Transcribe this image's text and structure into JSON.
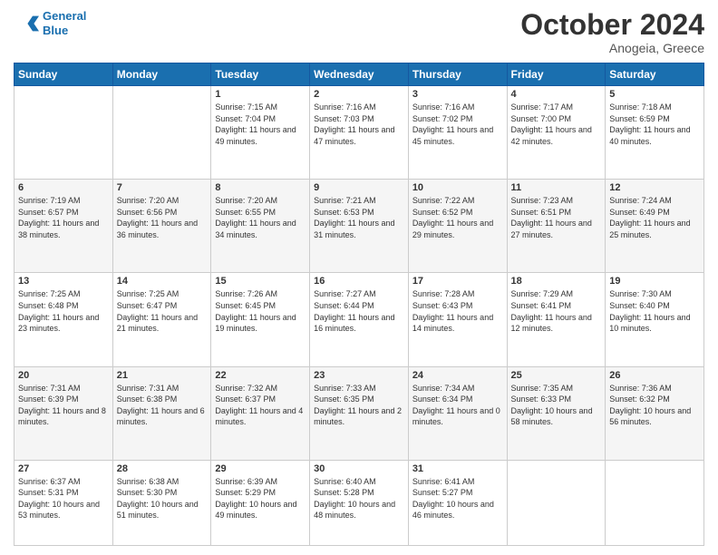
{
  "logo": {
    "line1": "General",
    "line2": "Blue"
  },
  "header": {
    "month": "October 2024",
    "location": "Anogeia, Greece"
  },
  "weekdays": [
    "Sunday",
    "Monday",
    "Tuesday",
    "Wednesday",
    "Thursday",
    "Friday",
    "Saturday"
  ],
  "weeks": [
    [
      {
        "day": "",
        "info": ""
      },
      {
        "day": "",
        "info": ""
      },
      {
        "day": "1",
        "info": "Sunrise: 7:15 AM\nSunset: 7:04 PM\nDaylight: 11 hours and 49 minutes."
      },
      {
        "day": "2",
        "info": "Sunrise: 7:16 AM\nSunset: 7:03 PM\nDaylight: 11 hours and 47 minutes."
      },
      {
        "day": "3",
        "info": "Sunrise: 7:16 AM\nSunset: 7:02 PM\nDaylight: 11 hours and 45 minutes."
      },
      {
        "day": "4",
        "info": "Sunrise: 7:17 AM\nSunset: 7:00 PM\nDaylight: 11 hours and 42 minutes."
      },
      {
        "day": "5",
        "info": "Sunrise: 7:18 AM\nSunset: 6:59 PM\nDaylight: 11 hours and 40 minutes."
      }
    ],
    [
      {
        "day": "6",
        "info": "Sunrise: 7:19 AM\nSunset: 6:57 PM\nDaylight: 11 hours and 38 minutes."
      },
      {
        "day": "7",
        "info": "Sunrise: 7:20 AM\nSunset: 6:56 PM\nDaylight: 11 hours and 36 minutes."
      },
      {
        "day": "8",
        "info": "Sunrise: 7:20 AM\nSunset: 6:55 PM\nDaylight: 11 hours and 34 minutes."
      },
      {
        "day": "9",
        "info": "Sunrise: 7:21 AM\nSunset: 6:53 PM\nDaylight: 11 hours and 31 minutes."
      },
      {
        "day": "10",
        "info": "Sunrise: 7:22 AM\nSunset: 6:52 PM\nDaylight: 11 hours and 29 minutes."
      },
      {
        "day": "11",
        "info": "Sunrise: 7:23 AM\nSunset: 6:51 PM\nDaylight: 11 hours and 27 minutes."
      },
      {
        "day": "12",
        "info": "Sunrise: 7:24 AM\nSunset: 6:49 PM\nDaylight: 11 hours and 25 minutes."
      }
    ],
    [
      {
        "day": "13",
        "info": "Sunrise: 7:25 AM\nSunset: 6:48 PM\nDaylight: 11 hours and 23 minutes."
      },
      {
        "day": "14",
        "info": "Sunrise: 7:25 AM\nSunset: 6:47 PM\nDaylight: 11 hours and 21 minutes."
      },
      {
        "day": "15",
        "info": "Sunrise: 7:26 AM\nSunset: 6:45 PM\nDaylight: 11 hours and 19 minutes."
      },
      {
        "day": "16",
        "info": "Sunrise: 7:27 AM\nSunset: 6:44 PM\nDaylight: 11 hours and 16 minutes."
      },
      {
        "day": "17",
        "info": "Sunrise: 7:28 AM\nSunset: 6:43 PM\nDaylight: 11 hours and 14 minutes."
      },
      {
        "day": "18",
        "info": "Sunrise: 7:29 AM\nSunset: 6:41 PM\nDaylight: 11 hours and 12 minutes."
      },
      {
        "day": "19",
        "info": "Sunrise: 7:30 AM\nSunset: 6:40 PM\nDaylight: 11 hours and 10 minutes."
      }
    ],
    [
      {
        "day": "20",
        "info": "Sunrise: 7:31 AM\nSunset: 6:39 PM\nDaylight: 11 hours and 8 minutes."
      },
      {
        "day": "21",
        "info": "Sunrise: 7:31 AM\nSunset: 6:38 PM\nDaylight: 11 hours and 6 minutes."
      },
      {
        "day": "22",
        "info": "Sunrise: 7:32 AM\nSunset: 6:37 PM\nDaylight: 11 hours and 4 minutes."
      },
      {
        "day": "23",
        "info": "Sunrise: 7:33 AM\nSunset: 6:35 PM\nDaylight: 11 hours and 2 minutes."
      },
      {
        "day": "24",
        "info": "Sunrise: 7:34 AM\nSunset: 6:34 PM\nDaylight: 11 hours and 0 minutes."
      },
      {
        "day": "25",
        "info": "Sunrise: 7:35 AM\nSunset: 6:33 PM\nDaylight: 10 hours and 58 minutes."
      },
      {
        "day": "26",
        "info": "Sunrise: 7:36 AM\nSunset: 6:32 PM\nDaylight: 10 hours and 56 minutes."
      }
    ],
    [
      {
        "day": "27",
        "info": "Sunrise: 6:37 AM\nSunset: 5:31 PM\nDaylight: 10 hours and 53 minutes."
      },
      {
        "day": "28",
        "info": "Sunrise: 6:38 AM\nSunset: 5:30 PM\nDaylight: 10 hours and 51 minutes."
      },
      {
        "day": "29",
        "info": "Sunrise: 6:39 AM\nSunset: 5:29 PM\nDaylight: 10 hours and 49 minutes."
      },
      {
        "day": "30",
        "info": "Sunrise: 6:40 AM\nSunset: 5:28 PM\nDaylight: 10 hours and 48 minutes."
      },
      {
        "day": "31",
        "info": "Sunrise: 6:41 AM\nSunset: 5:27 PM\nDaylight: 10 hours and 46 minutes."
      },
      {
        "day": "",
        "info": ""
      },
      {
        "day": "",
        "info": ""
      }
    ]
  ]
}
